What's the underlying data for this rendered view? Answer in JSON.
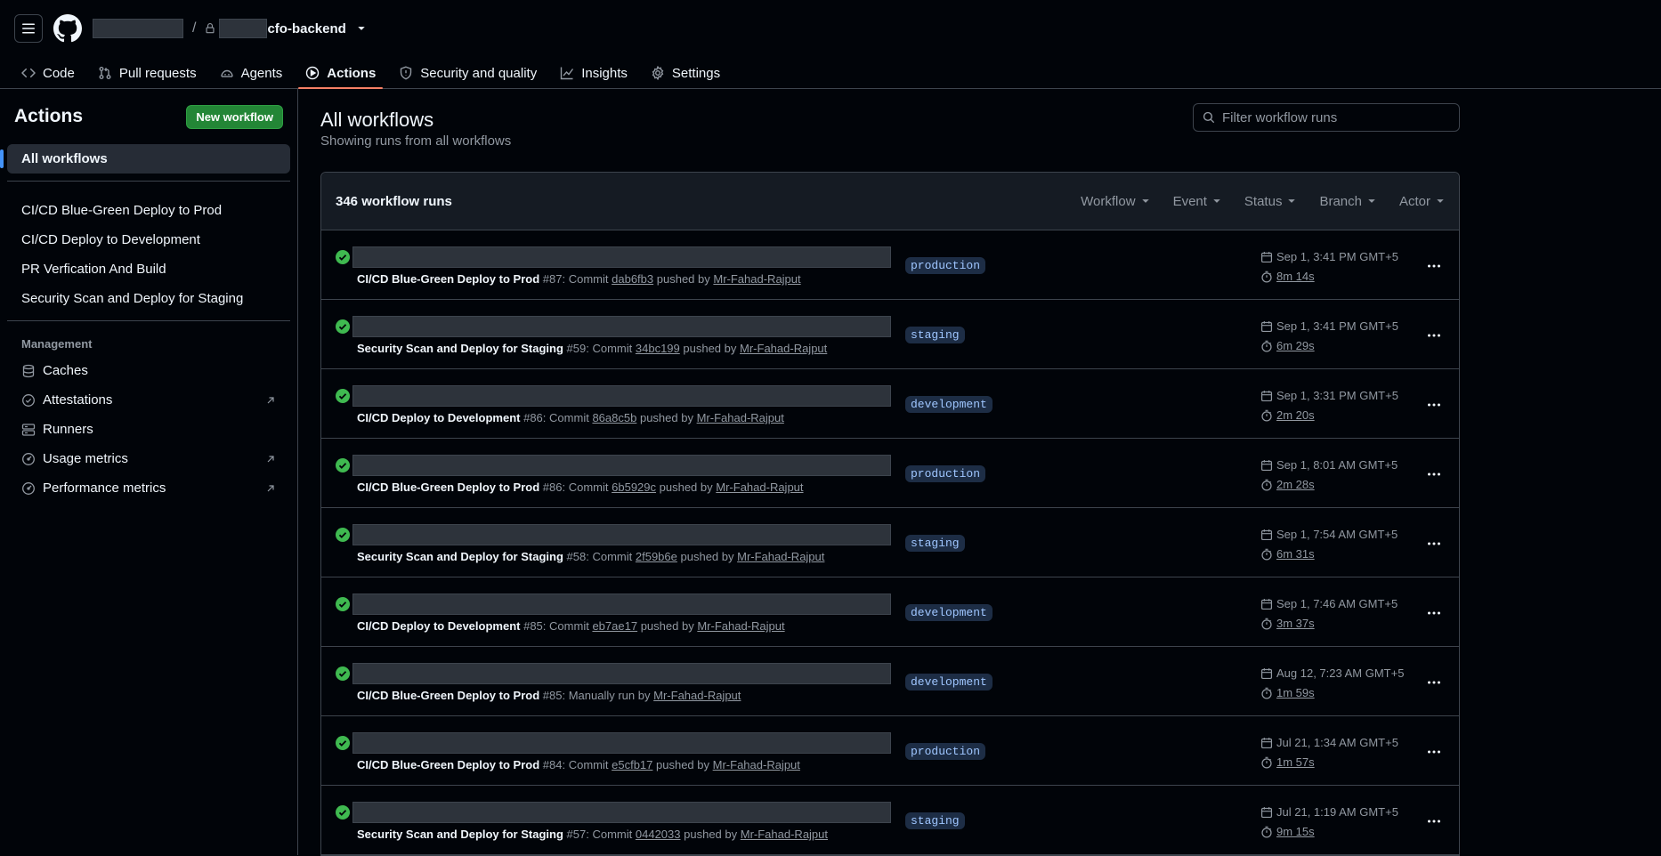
{
  "repo": {
    "name": "cfo-backend"
  },
  "nav": [
    {
      "label": "Code",
      "icon": "code-icon"
    },
    {
      "label": "Pull requests",
      "icon": "git-pull-request-icon"
    },
    {
      "label": "Agents",
      "icon": "agents-icon"
    },
    {
      "label": "Actions",
      "icon": "play-icon",
      "active": true
    },
    {
      "label": "Security and quality",
      "icon": "shield-icon"
    },
    {
      "label": "Insights",
      "icon": "graph-icon"
    },
    {
      "label": "Settings",
      "icon": "gear-icon"
    }
  ],
  "sidebar": {
    "title": "Actions",
    "new_workflow_label": "New workflow",
    "all_workflows_label": "All workflows",
    "workflows": [
      "CI/CD Blue-Green Deploy to Prod",
      "CI/CD Deploy to Development",
      "PR Verfication And Build",
      "Security Scan and Deploy for Staging"
    ],
    "management_label": "Management",
    "management": [
      {
        "label": "Caches",
        "icon": "cache-icon",
        "external": false
      },
      {
        "label": "Attestations",
        "icon": "verified-icon",
        "external": true
      },
      {
        "label": "Runners",
        "icon": "server-icon",
        "external": false
      },
      {
        "label": "Usage metrics",
        "icon": "meter-icon",
        "external": true
      },
      {
        "label": "Performance metrics",
        "icon": "meter-icon",
        "external": true
      }
    ]
  },
  "main": {
    "title": "All workflows",
    "subtitle": "Showing runs from all workflows",
    "filter_placeholder": "Filter workflow runs",
    "runs_count": "346 workflow runs",
    "filters": [
      "Workflow",
      "Event",
      "Status",
      "Branch",
      "Actor"
    ]
  },
  "runs": [
    {
      "workflow": "CI/CD Blue-Green Deploy to Prod",
      "number": "#87",
      "event": "Commit",
      "sha": "dab6fb3",
      "actor": "Mr-Fahad-Rajput",
      "branch": "production",
      "when": "Sep 1, 3:41 PM GMT+5",
      "duration": "8m 14s"
    },
    {
      "workflow": "Security Scan and Deploy for Staging",
      "number": "#59",
      "event": "Commit",
      "sha": "34bc199",
      "actor": "Mr-Fahad-Rajput",
      "branch": "staging",
      "when": "Sep 1, 3:41 PM GMT+5",
      "duration": "6m 29s"
    },
    {
      "workflow": "CI/CD Deploy to Development",
      "number": "#86",
      "event": "Commit",
      "sha": "86a8c5b",
      "actor": "Mr-Fahad-Rajput",
      "branch": "development",
      "when": "Sep 1, 3:31 PM GMT+5",
      "duration": "2m 20s"
    },
    {
      "workflow": "CI/CD Blue-Green Deploy to Prod",
      "number": "#86",
      "event": "Commit",
      "sha": "6b5929c",
      "actor": "Mr-Fahad-Rajput",
      "branch": "production",
      "when": "Sep 1, 8:01 AM GMT+5",
      "duration": "2m 28s"
    },
    {
      "workflow": "Security Scan and Deploy for Staging",
      "number": "#58",
      "event": "Commit",
      "sha": "2f59b6e",
      "actor": "Mr-Fahad-Rajput",
      "branch": "staging",
      "when": "Sep 1, 7:54 AM GMT+5",
      "duration": "6m 31s"
    },
    {
      "workflow": "CI/CD Deploy to Development",
      "number": "#85",
      "event": "Commit",
      "sha": "eb7ae17",
      "actor": "Mr-Fahad-Rajput",
      "branch": "development",
      "when": "Sep 1, 7:46 AM GMT+5",
      "duration": "3m 37s"
    },
    {
      "workflow": "CI/CD Blue-Green Deploy to Prod",
      "number": "#85",
      "event": "Manually run",
      "sha": "",
      "actor": "Mr-Fahad-Rajput",
      "branch": "development",
      "when": "Aug 12, 7:23 AM GMT+5",
      "duration": "1m 59s"
    },
    {
      "workflow": "CI/CD Blue-Green Deploy to Prod",
      "number": "#84",
      "event": "Commit",
      "sha": "e5cfb17",
      "actor": "Mr-Fahad-Rajput",
      "branch": "production",
      "when": "Jul 21, 1:34 AM GMT+5",
      "duration": "1m 57s"
    },
    {
      "workflow": "Security Scan and Deploy for Staging",
      "number": "#57",
      "event": "Commit",
      "sha": "0442033",
      "actor": "Mr-Fahad-Rajput",
      "branch": "staging",
      "when": "Jul 21, 1:19 AM GMT+5",
      "duration": "9m 15s"
    }
  ],
  "text": {
    "pushed_by": "pushed by",
    "by": "by",
    "colon": ":"
  },
  "colors": {
    "success": "#3fb950",
    "accent": "#4493f8",
    "nav_underline": "#f78166",
    "button_green": "#238636"
  }
}
